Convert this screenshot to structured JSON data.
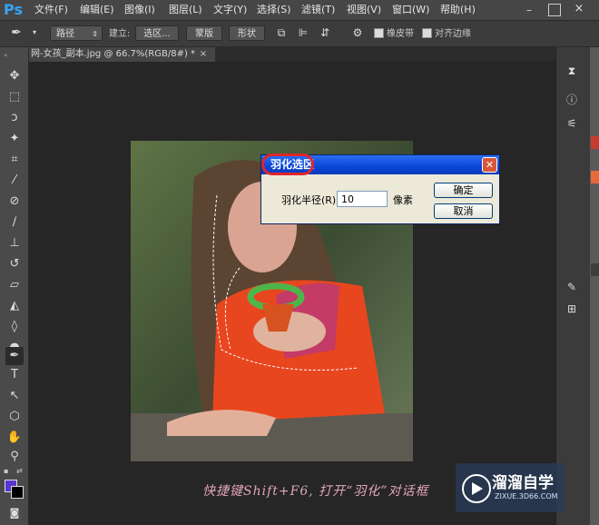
{
  "app": {
    "logo": "Ps"
  },
  "menu": [
    "文件(F)",
    "编辑(E)",
    "图像(I)",
    "图层(L)",
    "文字(Y)",
    "选择(S)",
    "滤镜(T)",
    "视图(V)",
    "窗口(W)",
    "帮助(H)"
  ],
  "options_bar": {
    "mode_value": "路径",
    "create_label": "建立:",
    "selection_button": "选区...",
    "mask_button": "蒙版",
    "shape_button": "形状",
    "rubber_band_label": "橡皮带",
    "align_edges_label": "对齐边缘"
  },
  "document": {
    "tab_title": "网-女孩_副本.jpg @ 66.7%(RGB/8#) *",
    "tab_close": "×"
  },
  "dialog": {
    "title": "羽化选区",
    "close": "✕",
    "radius_label": "羽化半径(R):",
    "radius_value": "10",
    "unit": "像素",
    "ok": "确定",
    "cancel": "取消"
  },
  "caption": "快捷键Shift+F6, 打开“羽化”对话框",
  "watermark": {
    "title": "溜溜自学",
    "subtitle": "ZIXUE.3D66.COM"
  },
  "colors": {
    "foreground": "#5a36d0",
    "background": "#000000",
    "highlight": "#e0262b",
    "accent": "#0b45d6"
  }
}
